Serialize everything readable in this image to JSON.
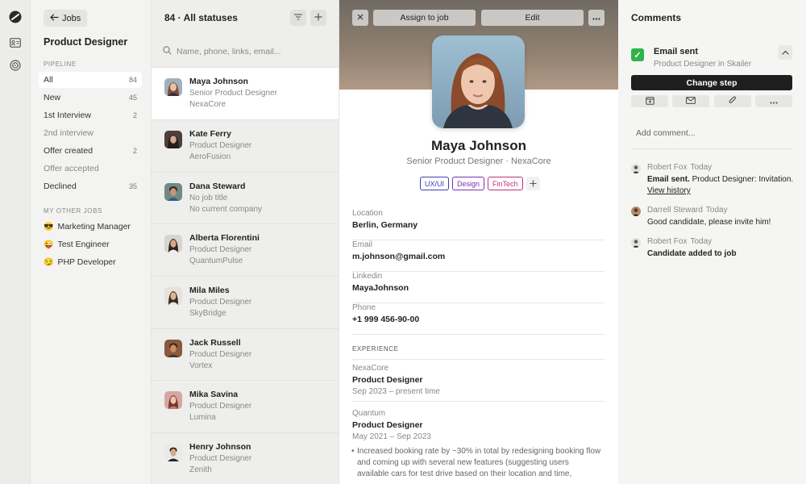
{
  "nav": {
    "back_label": "Jobs",
    "job_title": "Product Designer",
    "pipeline_label": "PIPELINE",
    "pipeline": [
      {
        "label": "All",
        "count": "84"
      },
      {
        "label": "New",
        "count": "45"
      },
      {
        "label": "1st Interview",
        "count": "2"
      },
      {
        "label": "2nd interview",
        "count": ""
      },
      {
        "label": "Offer created",
        "count": "2"
      },
      {
        "label": "Offer accepted",
        "count": ""
      },
      {
        "label": "Declined",
        "count": "35"
      }
    ],
    "other_jobs_label": "MY OTHER JOBS",
    "other_jobs": [
      {
        "emoji": "😎",
        "label": "Marketing Manager"
      },
      {
        "emoji": "😜",
        "label": "Test Engineer"
      },
      {
        "emoji": "😏",
        "label": "PHP Developer"
      }
    ]
  },
  "list": {
    "header": "84 · All statuses",
    "search_placeholder": "Name, phone, links, email...",
    "candidates": [
      {
        "name": "Maya Johnson",
        "role": "Senior Product Designer",
        "company": "NexaCore"
      },
      {
        "name": "Kate Ferry",
        "role": "Product Designer",
        "company": "AeroFusion"
      },
      {
        "name": "Dana Steward",
        "role": "No job title",
        "company": "No current company"
      },
      {
        "name": "Alberta Florentini",
        "role": "Product Designer",
        "company": "QuantumPulse"
      },
      {
        "name": "Mila Miles",
        "role": "Product Designer",
        "company": "SkyBridge"
      },
      {
        "name": "Jack Russell",
        "role": "Product Designer",
        "company": "Vortex"
      },
      {
        "name": "Mika Savina",
        "role": "Product Designer",
        "company": "Lumina"
      },
      {
        "name": "Henry Johnson",
        "role": "Product Designer",
        "company": "Zenith"
      }
    ]
  },
  "detail": {
    "assign_label": "Assign to job",
    "edit_label": "Edit",
    "name": "Maya Johnson",
    "subtitle": "Senior Product Designer · NexaCore",
    "tags": [
      {
        "label": "UX/UI",
        "color": "#3b3fb5"
      },
      {
        "label": "Design",
        "color": "#7a2fb0"
      },
      {
        "label": "FinTech",
        "color": "#c0307a"
      }
    ],
    "fields": [
      {
        "label": "Location",
        "value": "Berlin, Germany"
      },
      {
        "label": "Email",
        "value": "m.johnson@gmail.com"
      },
      {
        "label": "Linkedin",
        "value": "MayaJohnson"
      },
      {
        "label": "Phone",
        "value": "+1 999 456-90-00"
      }
    ],
    "experience_label": "EXPERIENCE",
    "experience": [
      {
        "company": "NexaCore",
        "title": "Product Designer",
        "dates": "Sep 2023 – present time"
      },
      {
        "company": "Quantum",
        "title": "Product Designer",
        "dates": "May 2021 – Sep 2023"
      }
    ],
    "bullet": "Increased booking rate by ~30% in total by redesigning booking flow and coming up with several new features (suggesting users available cars for test drive based on their location and time,"
  },
  "comments": {
    "title": "Comments",
    "event_title": "Email sent",
    "event_sub": "Product Designer in Skailer",
    "change_step_label": "Change step",
    "add_placeholder": "Add comment...",
    "items": [
      {
        "author": "Robert Fox",
        "time": "Today",
        "bold": "Email sent.",
        "text": " Product Designer: Invitation. ",
        "link": "View history"
      },
      {
        "author": "Darrell Steward",
        "time": "Today",
        "bold": "",
        "text": "Good candidate, please invite him!",
        "link": ""
      },
      {
        "author": "Robert Fox",
        "time": "Today",
        "bold": "Candidate added to job",
        "text": "",
        "link": ""
      }
    ]
  }
}
